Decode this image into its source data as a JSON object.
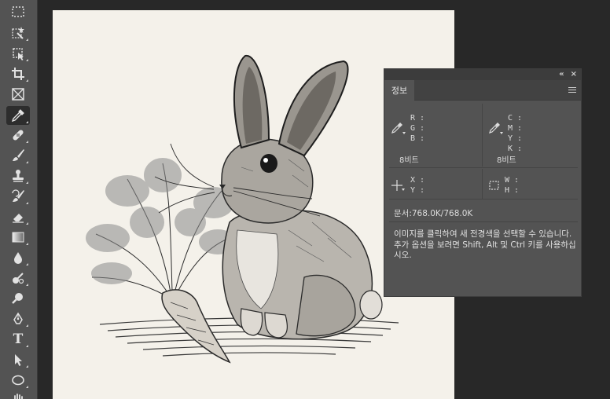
{
  "toolbar": {
    "tools": [
      {
        "name": "rectangular-marquee-tool",
        "icon": "marquee-icon"
      },
      {
        "name": "object-selection-tool",
        "icon": "magic-select-icon"
      },
      {
        "name": "artboard-tool",
        "icon": "artboard-icon"
      },
      {
        "name": "crop-tool",
        "icon": "crop-icon"
      },
      {
        "name": "frame-tool",
        "icon": "frame-icon"
      },
      {
        "name": "eyedropper-tool",
        "icon": "eyedropper-icon",
        "active": true
      },
      {
        "name": "healing-brush-tool",
        "icon": "bandage-icon"
      },
      {
        "name": "brush-tool",
        "icon": "brush-icon"
      },
      {
        "name": "clone-stamp-tool",
        "icon": "stamp-icon"
      },
      {
        "name": "history-brush-tool",
        "icon": "history-brush-icon"
      },
      {
        "name": "eraser-tool",
        "icon": "eraser-icon"
      },
      {
        "name": "gradient-tool",
        "icon": "gradient-icon"
      },
      {
        "name": "blur-tool",
        "icon": "droplet-icon"
      },
      {
        "name": "dodge-tool",
        "icon": "dodge-icon"
      },
      {
        "name": "pen-tool",
        "icon": "pen-icon"
      },
      {
        "name": "text-tool",
        "icon": "text-icon"
      },
      {
        "name": "path-selection-tool",
        "icon": "arrow-select-icon"
      },
      {
        "name": "ellipse-tool",
        "icon": "ellipse-icon"
      },
      {
        "name": "hand-tool",
        "icon": "hand-icon"
      }
    ],
    "text_glyph": "T"
  },
  "panel": {
    "tab_label": "정보",
    "collapse_glyph": "«",
    "close_glyph": "×",
    "rgb": {
      "labels": [
        "R :",
        "G :",
        "B :"
      ],
      "bit_depth": "8비트"
    },
    "cmyk": {
      "labels": [
        "C :",
        "M :",
        "Y :",
        "K :"
      ],
      "bit_depth": "8비트"
    },
    "xy": {
      "labels": [
        "X :",
        "Y :"
      ]
    },
    "wh": {
      "labels": [
        "W :",
        "H :"
      ]
    },
    "document": "문서:768.0K/768.0K",
    "description": "이미지를 클릭하여 새 전경색을 선택할 수 있습니다. 추가 옵션을 보려면 Shift, Alt 및 Ctrl 키를 사용하십시오."
  },
  "colors": {
    "toolbar_bg": "#535353",
    "workspace_bg": "#282828",
    "panel_bg": "#535353",
    "canvas_bg": "#f4f1ea"
  }
}
